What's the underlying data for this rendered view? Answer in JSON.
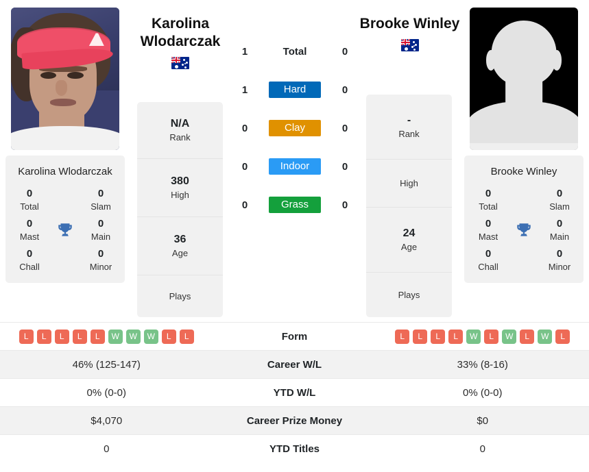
{
  "players": {
    "left": {
      "name_header": "Karolina Wlodarczak",
      "card_name": "Karolina Wlodarczak",
      "country_flag": "australia-flag",
      "photo": "player-photo",
      "titles": [
        {
          "value": "0",
          "label": "Total"
        },
        {
          "value": "0",
          "label": "Slam"
        },
        {
          "value": "0",
          "label": "Mast"
        },
        {
          "value": "0",
          "label": "Main"
        },
        {
          "value": "0",
          "label": "Chall"
        },
        {
          "value": "0",
          "label": "Minor"
        }
      ],
      "info": [
        {
          "value": "N/A",
          "label": "Rank"
        },
        {
          "value": "380",
          "label": "High"
        },
        {
          "value": "36",
          "label": "Age"
        },
        {
          "value": "",
          "label": "Plays"
        }
      ],
      "form": [
        "L",
        "L",
        "L",
        "L",
        "L",
        "W",
        "W",
        "W",
        "L",
        "L"
      ],
      "career_wl": "46% (125-147)",
      "ytd_wl": "0% (0-0)",
      "career_prize_money": "$4,070",
      "ytd_titles": "0",
      "h2h": {
        "total": "1",
        "hard": "1",
        "clay": "0",
        "indoor": "0",
        "grass": "0"
      }
    },
    "right": {
      "name_header": "Brooke Winley",
      "card_name": "Brooke Winley",
      "country_flag": "australia-flag",
      "photo": "player-photo-placeholder",
      "titles": [
        {
          "value": "0",
          "label": "Total"
        },
        {
          "value": "0",
          "label": "Slam"
        },
        {
          "value": "0",
          "label": "Mast"
        },
        {
          "value": "0",
          "label": "Main"
        },
        {
          "value": "0",
          "label": "Chall"
        },
        {
          "value": "0",
          "label": "Minor"
        }
      ],
      "info": [
        {
          "value": "-",
          "label": "Rank"
        },
        {
          "value": "",
          "label": "High"
        },
        {
          "value": "24",
          "label": "Age"
        },
        {
          "value": "",
          "label": "Plays"
        }
      ],
      "form": [
        "L",
        "L",
        "L",
        "L",
        "W",
        "L",
        "W",
        "L",
        "W",
        "L"
      ],
      "career_wl": "33% (8-16)",
      "ytd_wl": "0% (0-0)",
      "career_prize_money": "$0",
      "ytd_titles": "0",
      "h2h": {
        "total": "0",
        "hard": "0",
        "clay": "0",
        "indoor": "0",
        "grass": "0"
      }
    }
  },
  "h2h_rows": [
    {
      "key": "total",
      "label": "Total",
      "badge": false,
      "color": ""
    },
    {
      "key": "hard",
      "label": "Hard",
      "badge": true,
      "color": "#0169b8"
    },
    {
      "key": "clay",
      "label": "Clay",
      "badge": true,
      "color": "#e09100"
    },
    {
      "key": "indoor",
      "label": "Indoor",
      "badge": true,
      "color": "#2a9bf5"
    },
    {
      "key": "grass",
      "label": "Grass",
      "badge": true,
      "color": "#14a03c"
    }
  ],
  "stats_rows": [
    {
      "label": "Form"
    },
    {
      "label": "Career W/L"
    },
    {
      "label": "YTD W/L"
    },
    {
      "label": "Career Prize Money"
    },
    {
      "label": "YTD Titles"
    }
  ],
  "icons": {
    "trophy": "trophy-icon"
  },
  "colors": {
    "hard": "#0169b8",
    "clay": "#e09100",
    "indoor": "#2a9bf5",
    "grass": "#14a03c",
    "win": "#78c389",
    "loss": "#ee6a56",
    "trophy": "#3c6fb3",
    "card_bg": "#f1f1f1"
  }
}
